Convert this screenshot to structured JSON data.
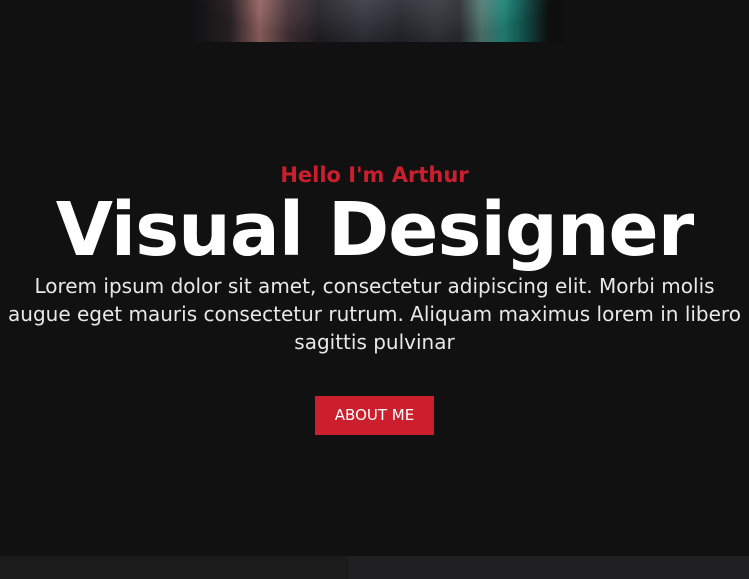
{
  "hero": {
    "greeting": "Hello I'm Arthur",
    "title": "Visual Designer",
    "description": "Lorem ipsum dolor sit amet, consectetur adipiscing elit. Morbi molis augue eget mauris consectetur rutrum. Aliquam maximus lorem in libero sagittis pulvinar",
    "button_label": "ABOUT ME"
  },
  "colors": {
    "background": "#111112",
    "accent": "#cc1f2e",
    "text": "#ffffff"
  }
}
